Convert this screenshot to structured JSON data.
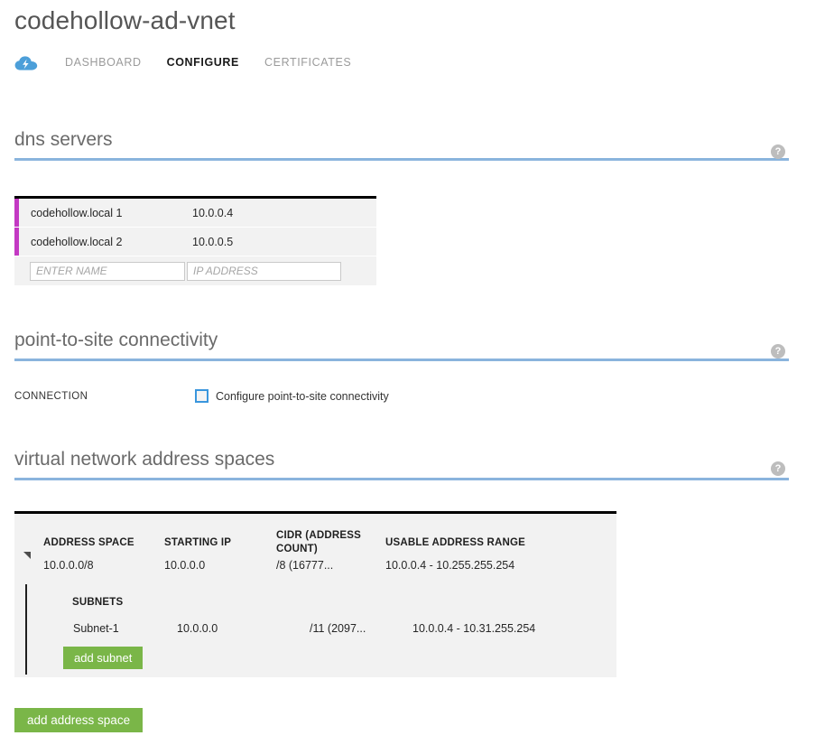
{
  "header": {
    "title": "codehollow-ad-vnet",
    "icon": "virtual-network-cloud-icon",
    "tabs": [
      {
        "label": "DASHBOARD",
        "active": false
      },
      {
        "label": "CONFIGURE",
        "active": true
      },
      {
        "label": "CERTIFICATES",
        "active": false
      }
    ]
  },
  "sections": {
    "dns": {
      "title": "dns servers",
      "help": "?",
      "rows": [
        {
          "name": "codehollow.local 1",
          "ip": "10.0.0.4"
        },
        {
          "name": "codehollow.local 2",
          "ip": "10.0.0.5"
        }
      ],
      "new_row": {
        "name_value": "",
        "name_placeholder": "ENTER NAME",
        "ip_value": "",
        "ip_placeholder": "IP ADDRESS"
      }
    },
    "point_to_site": {
      "title": "point-to-site connectivity",
      "help": "?",
      "connection_label": "CONNECTION",
      "checkbox_label": "Configure point-to-site connectivity",
      "checked": false
    },
    "address_spaces": {
      "title": "virtual network address spaces",
      "help": "?",
      "columns": [
        "ADDRESS SPACE",
        "STARTING IP",
        "CIDR (ADDRESS COUNT)",
        "USABLE ADDRESS RANGE"
      ],
      "address_space": {
        "name": "10.0.0.0/8",
        "starting_ip": "10.0.0.0",
        "cidr": "/8 (16777...",
        "usable_range": "10.0.0.4 - 10.255.255.254",
        "expanded": true
      },
      "subnets_label": "SUBNETS",
      "subnets": [
        {
          "name": "Subnet-1",
          "starting_ip": "10.0.0.0",
          "cidr": "/11 (2097...",
          "usable_range": "10.0.0.4 - 10.31.255.254"
        }
      ],
      "add_subnet_label": "add subnet",
      "add_address_space_label": "add address space"
    }
  },
  "colors": {
    "accent_blue": "#8ab4dd",
    "dns_row_accent": "#c339c3",
    "button_green": "#7ab648",
    "checkbox_border": "#3a96dd"
  }
}
